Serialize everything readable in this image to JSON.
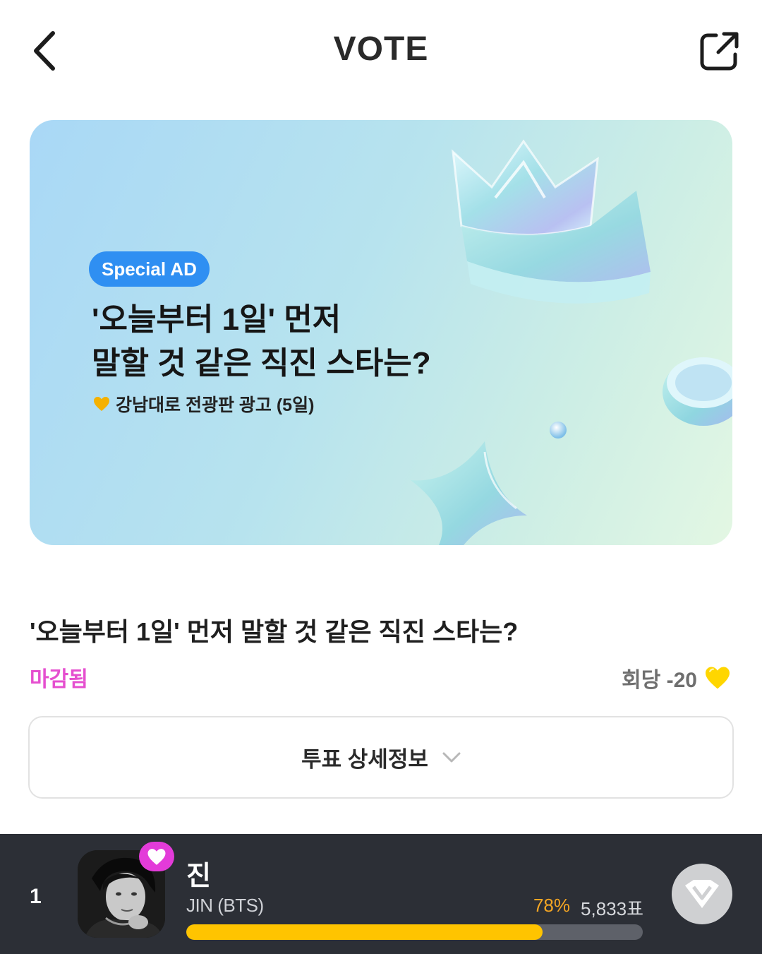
{
  "header": {
    "title": "VOTE",
    "back_icon": "chevron-left-icon",
    "share_icon": "share-external-icon"
  },
  "banner": {
    "badge": "Special AD",
    "headline_line1": "'오늘부터 1일' 먼저",
    "headline_line2": "말할 것 같은 직진 스타는?",
    "reward_text": "강남대로 전광판 광고 (5일)"
  },
  "vote": {
    "title": "'오늘부터 1일' 먼저 말할 것 같은 직진 스타는?",
    "status": "마감됨",
    "cost_text": "회당 -20",
    "details_label": "투표 상세정보"
  },
  "ranking": [
    {
      "rank": "1",
      "name": "진",
      "subname": "JIN (BTS)",
      "percent_text": "78%",
      "percent": 78,
      "votes": "5,833표"
    }
  ],
  "colors": {
    "accent_pink": "#e54fcf",
    "badge_blue": "#2f8ff2",
    "bar_yellow": "#ffc400",
    "percent_orange": "#f5a623",
    "row_bg": "#2c2f36"
  }
}
